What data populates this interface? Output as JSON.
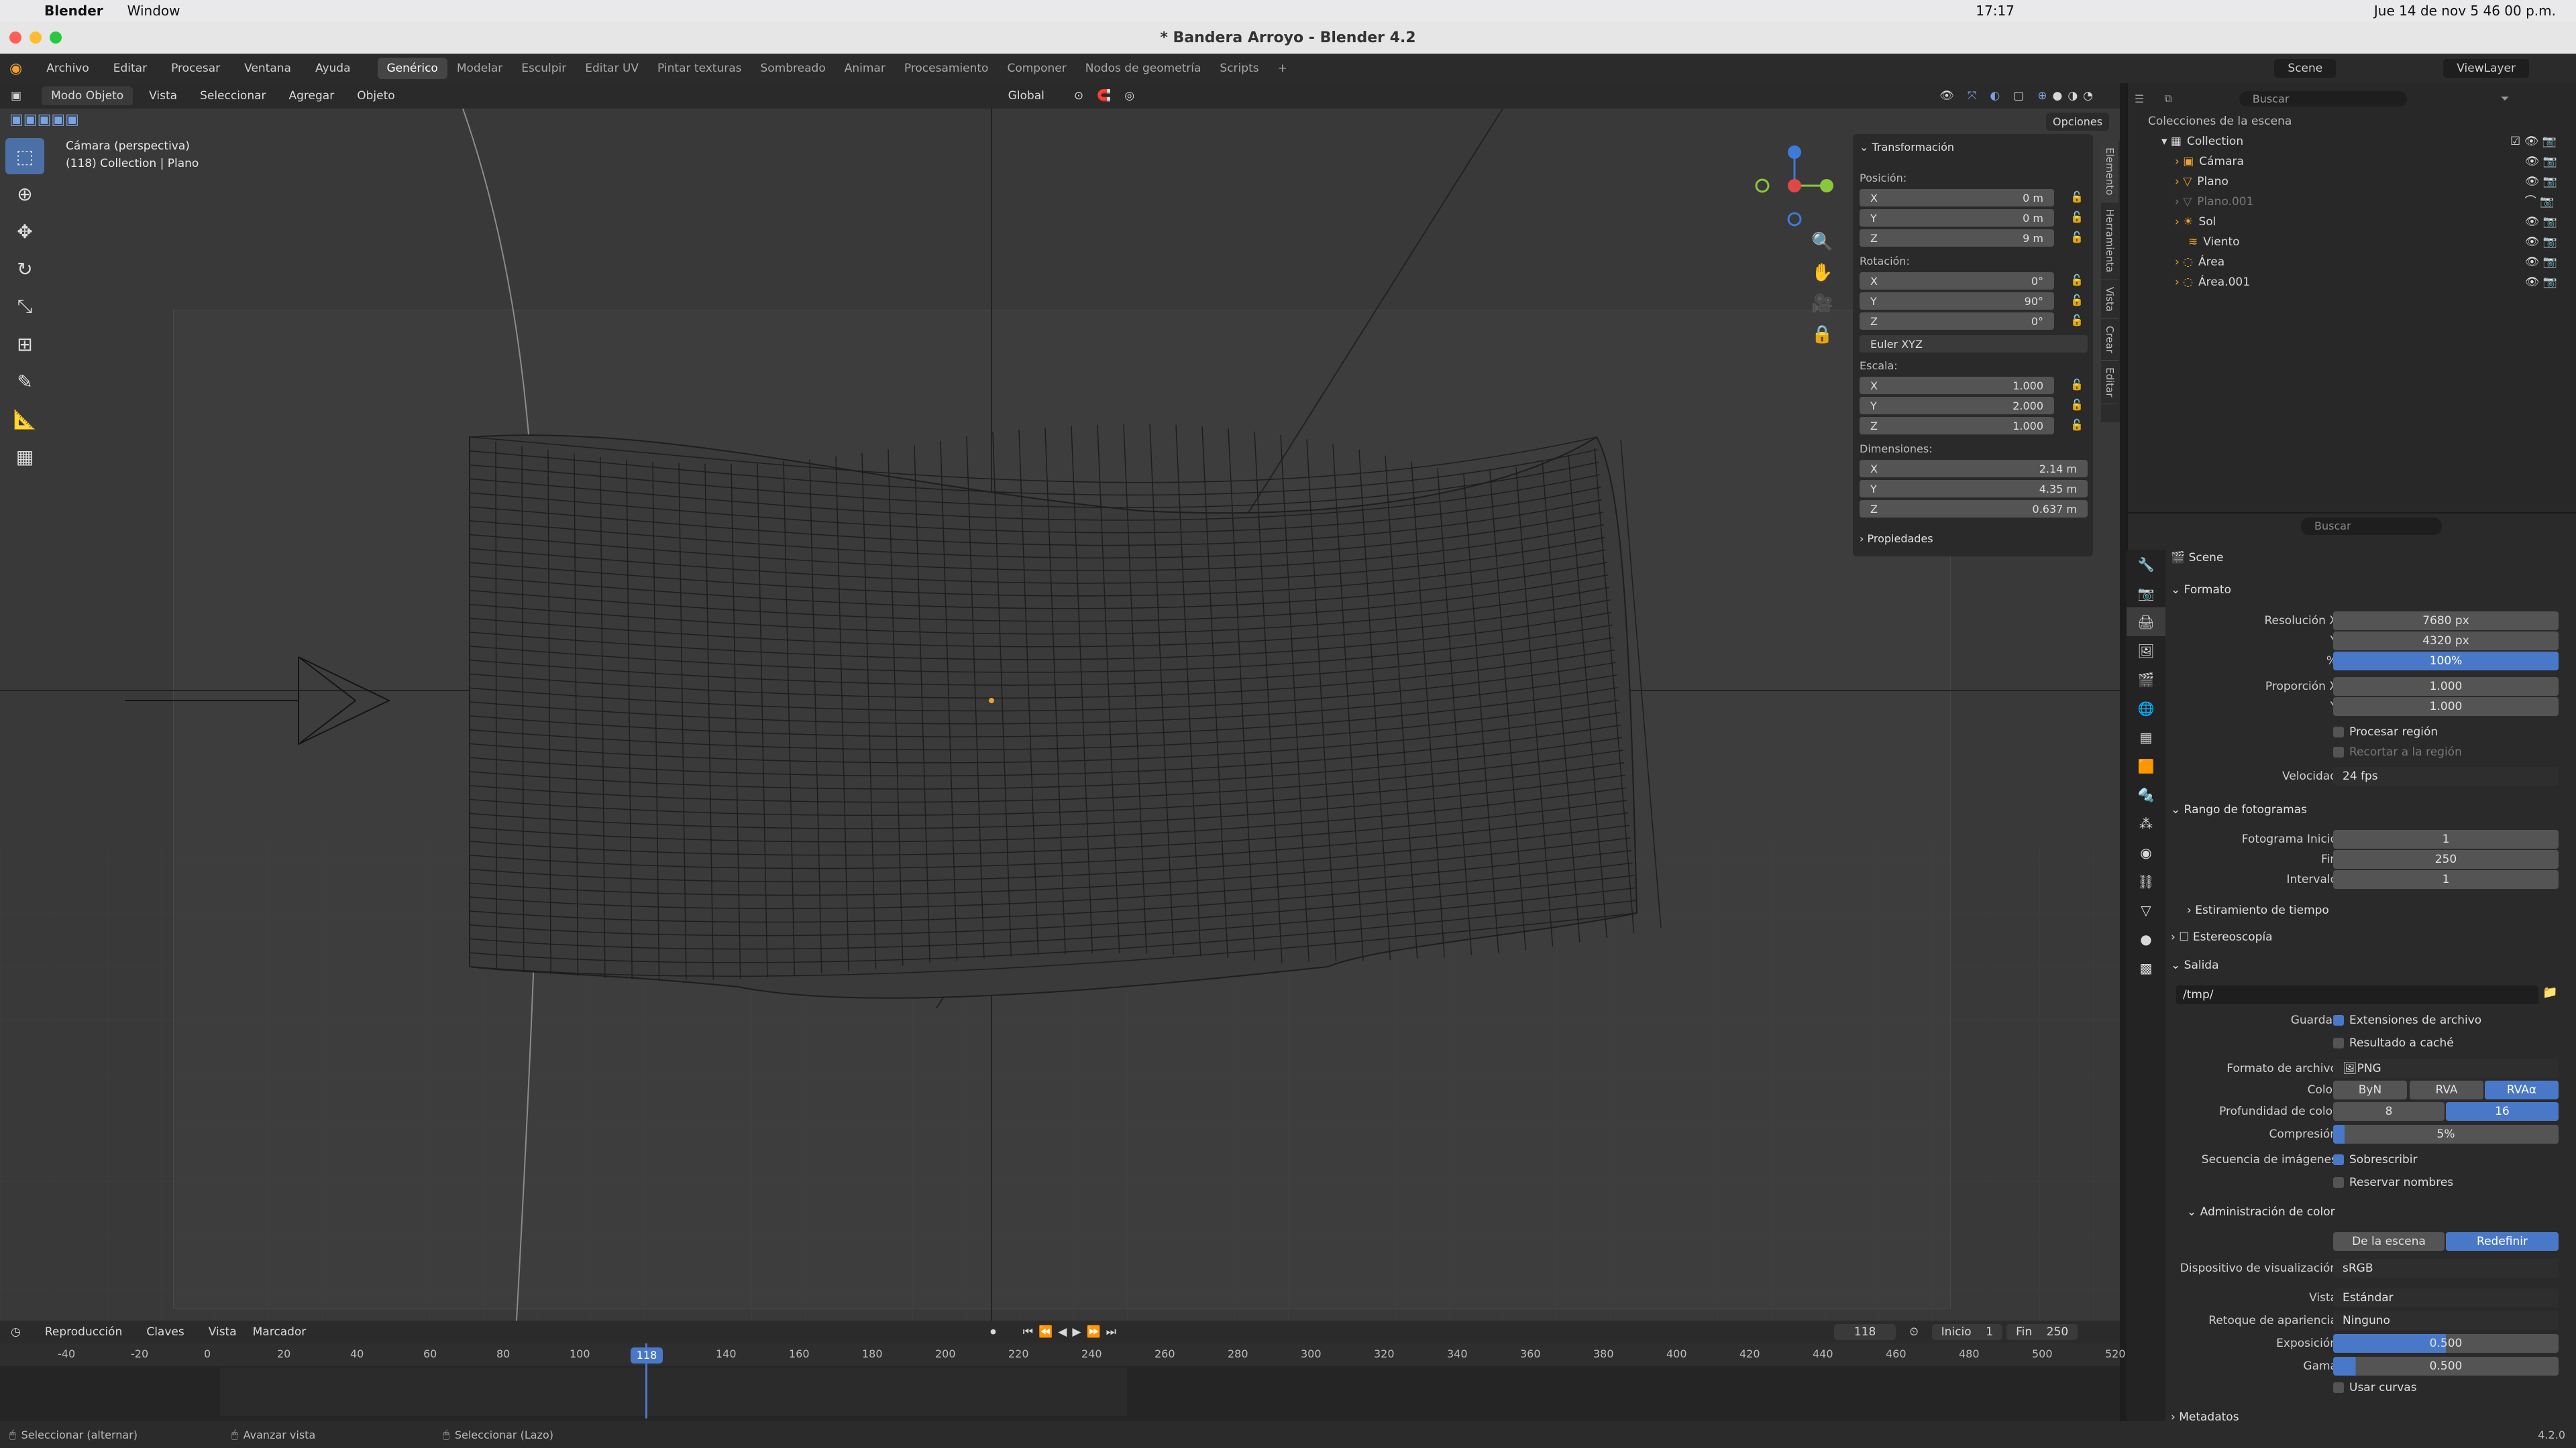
{
  "os_menu": {
    "apple": "",
    "app": "Blender",
    "window": "Window",
    "clock": "17:17",
    "datetime": "Jue 14 de nov  5 46 00 p.m."
  },
  "window_title": "* Bandera Arroyo - Blender 4.2",
  "app_menu": [
    "Archivo",
    "Editar",
    "Procesar",
    "Ventana",
    "Ayuda"
  ],
  "workspaces": [
    "Genérico",
    "Modelar",
    "Esculpir",
    "Editar UV",
    "Pintar texturas",
    "Sombreado",
    "Animar",
    "Procesamiento",
    "Componer",
    "Nodos de geometría",
    "Scripts"
  ],
  "active_workspace": "Genérico",
  "viewport_header": {
    "mode": "Modo Objeto",
    "menus": [
      "Vista",
      "Seleccionar",
      "Agregar",
      "Objeto"
    ],
    "orientation": "Global",
    "options": "Opciones"
  },
  "viewport_overlay": {
    "line1": "Cámara (perspectiva)",
    "line2": "(118) Collection | Plano"
  },
  "npanel": {
    "section": "Transformación",
    "pos_label": "Posición:",
    "pos": {
      "x": "0 m",
      "y": "0 m",
      "z": "9 m"
    },
    "rot_label": "Rotación:",
    "rot": {
      "x": "0°",
      "y": "90°",
      "z": "0°"
    },
    "rot_mode": "Euler XYZ",
    "scale_label": "Escala:",
    "scale": {
      "x": "1.000",
      "y": "2.000",
      "z": "1.000"
    },
    "dim_label": "Dimensiones:",
    "dim": {
      "x": "2.14 m",
      "y": "4.35 m",
      "z": "0.637 m"
    },
    "props": "Propiedades",
    "axis": [
      "X",
      "Y",
      "Z"
    ]
  },
  "side_tabs": [
    "Elemento",
    "Herramienta",
    "Vista",
    "Crear",
    "Editar"
  ],
  "outliner": {
    "root": "Colecciones de la escena",
    "scene": "Scene",
    "viewlayer": "ViewLayer",
    "search": "Buscar",
    "items": [
      "Collection",
      "Cámara",
      "Plano",
      "Plano.001",
      "Sol",
      "Viento",
      "Área",
      "Área.001"
    ]
  },
  "props": {
    "search": "Buscar",
    "context": "Scene",
    "formato": "Formato",
    "res_x_label": "Resolución X",
    "res_x": "7680 px",
    "res_y_label": "Y",
    "res_y": "4320 px",
    "pct_label": "%",
    "pct": "100%",
    "prop_x_label": "Proporción X",
    "prop_x": "1.000",
    "prop_y_label": "Y",
    "prop_y": "1.000",
    "procesar_region": "Procesar región",
    "recortar": "Recortar a la región",
    "vel_label": "Velocidad",
    "vel": "24 fps",
    "rango": "Rango de fotogramas",
    "inicio_label": "Fotograma Inicio",
    "inicio": "1",
    "fin_label": "Fin",
    "fin": "250",
    "intervalo_label": "Intervalo",
    "intervalo": "1",
    "estiramiento": "Estiramiento de tiempo",
    "estereo": "Estereoscopía",
    "salida": "Salida",
    "path": "/tmp/",
    "guardar_label": "Guardar",
    "ext": "Extensiones de archivo",
    "cache": "Resultado a caché",
    "formato_arch_label": "Formato de archivo",
    "formato_arch": "PNG",
    "color_label": "Color",
    "color_opts": [
      "ByN",
      "RVA",
      "RVAα"
    ],
    "prof_label": "Profundidad de color",
    "prof_opts": [
      "8",
      "16"
    ],
    "comp_label": "Compresión",
    "comp": "5%",
    "sec_label": "Secuencia de imágenes",
    "sobrescribir": "Sobrescribir",
    "reservar": "Reservar nombres",
    "admin": "Administración de color",
    "admin_opts": [
      "De la escena",
      "Redefinir"
    ],
    "disp_label": "Dispositivo de visualización",
    "disp": "sRGB",
    "vista_label": "Vista",
    "vista": "Estándar",
    "retoque_label": "Retoque de apariencia",
    "retoque": "Ninguno",
    "expo_label": "Exposición",
    "expo": "0.500",
    "gama_label": "Gama",
    "gama": "0.500",
    "curvas": "Usar curvas",
    "metadatos": "Metadatos"
  },
  "timeline": {
    "menus": [
      "Reproducción",
      "Claves",
      "Vista",
      "Marcador"
    ],
    "current": "118",
    "inicio_label": "Inicio",
    "inicio": "1",
    "fin_label": "Fin",
    "fin": "250",
    "ticks": [
      "-40",
      "-20",
      "0",
      "20",
      "40",
      "60",
      "80",
      "100",
      "118",
      "140",
      "160",
      "180",
      "200",
      "220",
      "240",
      "260",
      "280",
      "300",
      "320",
      "340",
      "360",
      "380",
      "400",
      "420",
      "440",
      "460",
      "480",
      "500",
      "520"
    ]
  },
  "status": {
    "s1": "Seleccionar (alternar)",
    "s2": "Avanzar vista",
    "s3": "Seleccionar (Lazo)",
    "version": "4.2.0"
  },
  "colors": {
    "accent": "#4a78c8",
    "bg": "#393939",
    "x_axis": "#e04848",
    "y_axis": "#8cc63f",
    "z_axis": "#3d7bd8"
  }
}
